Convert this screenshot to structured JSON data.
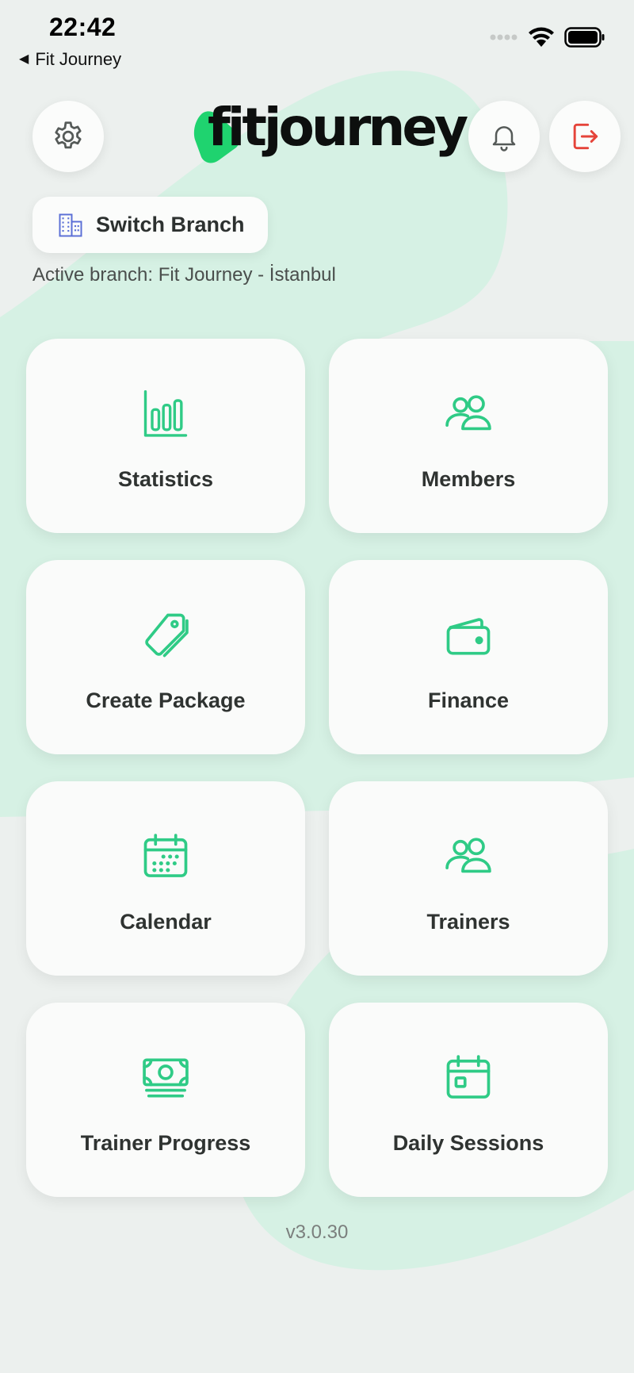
{
  "status_bar": {
    "time": "22:42",
    "back_label": "Fit Journey",
    "icons": [
      "signal-icon",
      "wifi-icon",
      "battery-icon"
    ]
  },
  "header": {
    "logo_text": "fitjourney",
    "settings_icon": "gear-icon",
    "notifications_icon": "bell-icon",
    "logout_icon": "logout-icon"
  },
  "branch": {
    "switch_label": "Switch Branch",
    "switch_icon": "building-icon",
    "active_text": "Active branch: Fit Journey - İstanbul"
  },
  "menu": {
    "items": [
      {
        "label": "Statistics",
        "icon": "bar-chart-icon"
      },
      {
        "label": "Members",
        "icon": "users-icon"
      },
      {
        "label": "Create Package",
        "icon": "tag-icon"
      },
      {
        "label": "Finance",
        "icon": "wallet-icon"
      },
      {
        "label": "Calendar",
        "icon": "calendar-icon"
      },
      {
        "label": "Trainers",
        "icon": "users-icon"
      },
      {
        "label": "Trainer Progress",
        "icon": "banknote-icon"
      },
      {
        "label": "Daily Sessions",
        "icon": "calendar-day-icon"
      }
    ]
  },
  "footer": {
    "version": "v3.0.30"
  },
  "colors": {
    "accent": "#2fcb86",
    "logo_green": "#1fd36f",
    "background": "#ecf0ee",
    "blob": "#d6f1e4",
    "logout_red": "#e5443a",
    "branch_icon_blue": "#5b6fd6"
  }
}
